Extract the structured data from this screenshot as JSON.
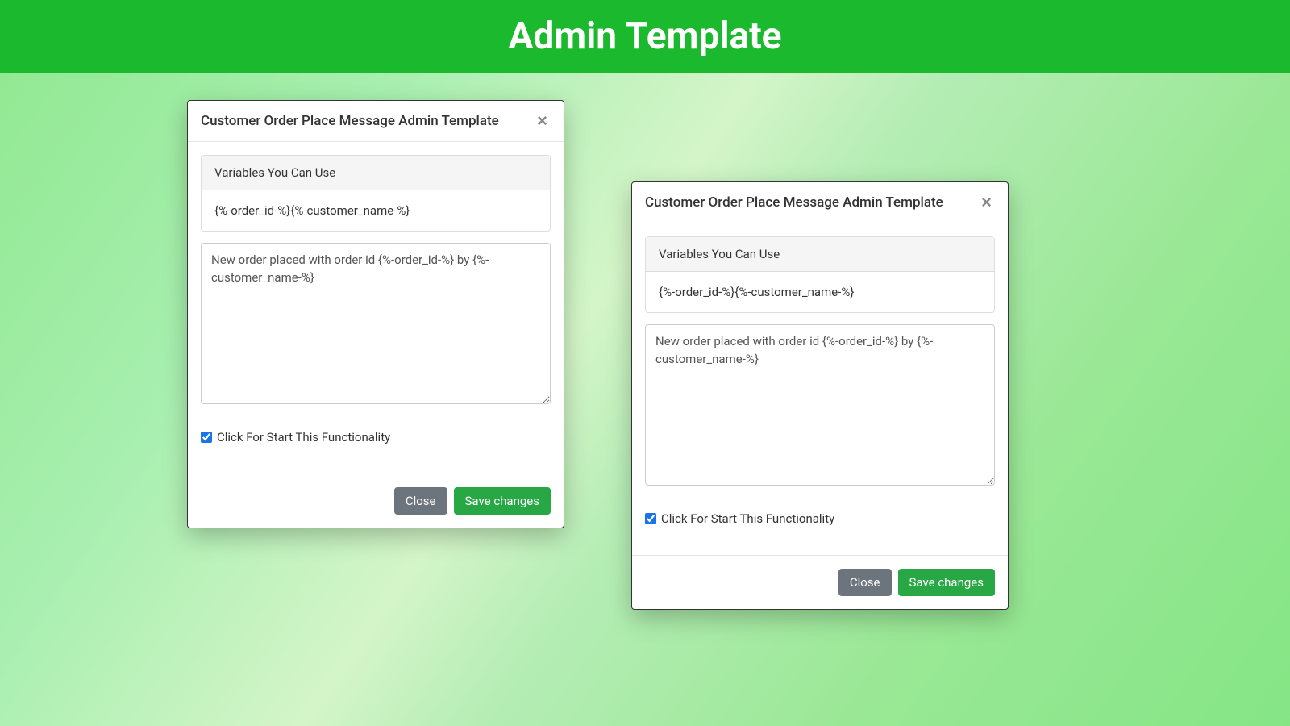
{
  "header": {
    "title": "Admin Template"
  },
  "modal1": {
    "title": "Customer Order Place Message Admin Template",
    "variables_header": "Variables You Can Use",
    "variables_body": "{%-order_id-%}{%-customer_name-%}",
    "message_value": "New order placed with order id {%-order_id-%} by {%-customer_name-%}",
    "checkbox_label": "Click For Start This Functionality",
    "close_button": "Close",
    "save_button": "Save changes"
  },
  "modal2": {
    "title": "Customer Order Place Message Admin Template",
    "variables_header": "Variables You Can Use",
    "variables_body": "{%-order_id-%}{%-customer_name-%}",
    "message_value": "New order placed with order id {%-order_id-%} by {%-customer_name-%}",
    "checkbox_label": "Click For Start This Functionality",
    "close_button": "Close",
    "save_button": "Save changes"
  }
}
